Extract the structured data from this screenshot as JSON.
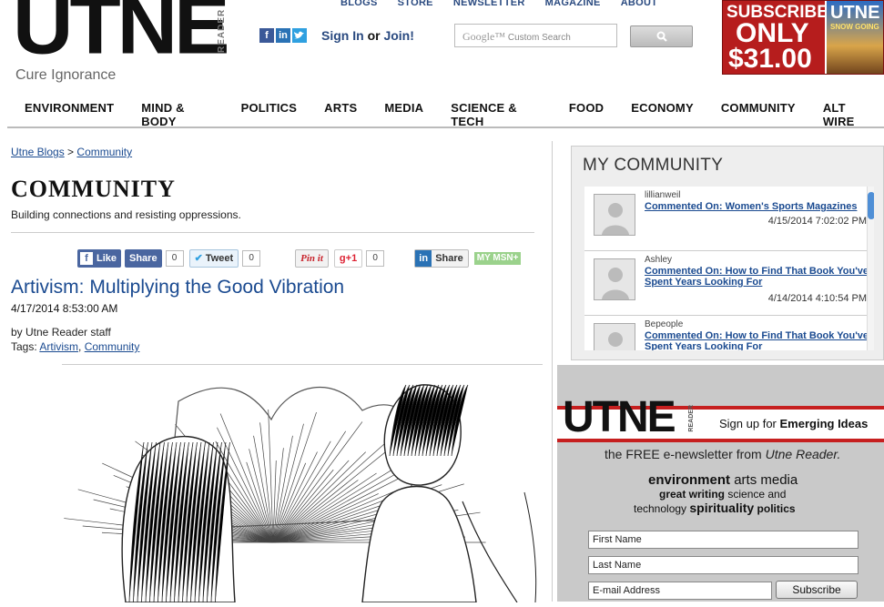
{
  "brand": {
    "logo": "UTNE",
    "logo_sub": "READER",
    "tagline": "Cure Ignorance"
  },
  "top_nav": [
    "BLOGS",
    "STORE",
    "NEWSLETTER",
    "MAGAZINE",
    "ABOUT"
  ],
  "social_icons": [
    "facebook-icon",
    "linkedin-icon",
    "twitter-icon"
  ],
  "account": {
    "sign_in": "Sign In",
    "or": "or",
    "join": "Join!"
  },
  "search": {
    "google": "Google™",
    "placeholder": "Custom Search"
  },
  "sub_ad": {
    "line1": "SUBSCRIBE",
    "line2": "ONLY",
    "line3": "$31.00",
    "mag_title": "UTNE",
    "mag_story": "SNOW GOING"
  },
  "main_nav": [
    "ENVIRONMENT",
    "MIND & BODY",
    "POLITICS",
    "ARTS",
    "MEDIA",
    "SCIENCE & TECH",
    "FOOD",
    "ECONOMY",
    "COMMUNITY",
    "ALT WIRE"
  ],
  "breadcrumb": {
    "root": "Utne Blogs",
    "sep": ">",
    "current": "Community"
  },
  "section": {
    "title": "COMMUNITY",
    "subtitle": "Building connections and resisting oppressions."
  },
  "share": {
    "like": "Like",
    "fb_share": "Share",
    "fb_count": "0",
    "tweet": "Tweet",
    "tweet_count": "0",
    "pin": "Pin it",
    "gplus": "g+1",
    "gplus_count": "0",
    "li_share": "Share",
    "msn": "MY MSN+"
  },
  "article": {
    "title": "Artivism: Multiplying the Good Vibration",
    "date": "4/17/2014 8:53:00 AM",
    "byline": "by Utne Reader staff",
    "tags_label": "Tags:",
    "tags": [
      "Artivism",
      "Community"
    ]
  },
  "my_community": {
    "title": "MY COMMUNITY",
    "items": [
      {
        "user": "lillianweil",
        "action": "Commented On: Women's Sports Magazines",
        "time": "4/15/2014 7:02:02 PM"
      },
      {
        "user": "Ashley",
        "action": "Commented On: How to Find That Book You've Spent Years Looking For",
        "time": "4/14/2014 4:10:54 PM"
      },
      {
        "user": "Bepeople",
        "action": "Commented On: How to Find That Book You've Spent Years Looking For",
        "time": ""
      }
    ]
  },
  "newsletter": {
    "logo": "UTNE",
    "logo_sub": "READER",
    "signup_prefix": "Sign up for",
    "signup_bold": "Emerging Ideas",
    "free_prefix": "the FREE e-newsletter from",
    "free_em": "Utne Reader.",
    "line1_bold": "environment",
    "line1_rest": "arts media",
    "line2_bold": "great writing",
    "line2_rest": "science and",
    "line3_pre": "technology",
    "line3_mid": "spirituality",
    "line3_end": "politics",
    "first_name": "First Name",
    "last_name": "Last Name",
    "email": "E-mail Address",
    "subscribe": "Subscribe"
  },
  "colors": {
    "link": "#1a4a90",
    "nav_link": "#2a4a80",
    "accent_red": "#c61f1f",
    "fb": "#4a66a0"
  }
}
